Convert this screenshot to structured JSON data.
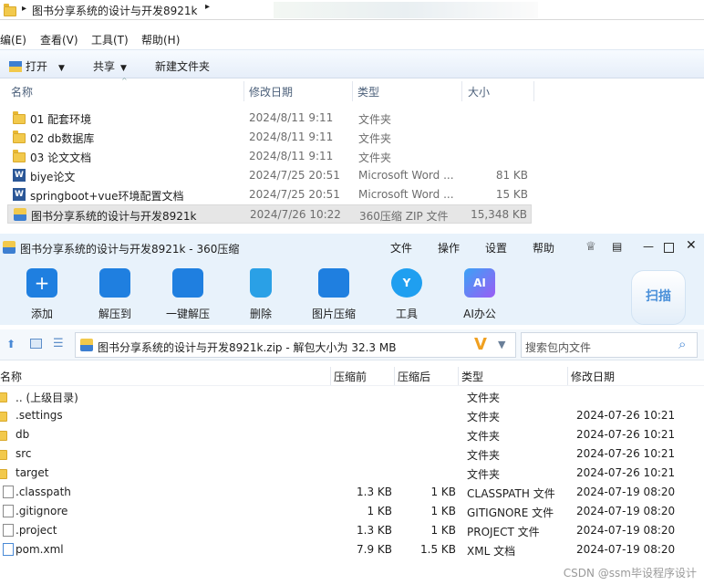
{
  "explorer": {
    "breadcrumb": "图书分享系统的设计与开发8921k",
    "menu": [
      "编(E)",
      "查看(V)",
      "工具(T)",
      "帮助(H)"
    ],
    "toolbar": {
      "open": "打开",
      "share": "共享",
      "new_folder": "新建文件夹"
    },
    "columns": [
      "名称",
      "修改日期",
      "类型",
      "大小"
    ],
    "files": [
      {
        "name": "01 配套环境",
        "date": "2024/8/11 9:11",
        "type": "文件夹",
        "size": "",
        "icon": "folder-icon"
      },
      {
        "name": "02 db数据库",
        "date": "2024/8/11 9:11",
        "type": "文件夹",
        "size": "",
        "icon": "folder-icon"
      },
      {
        "name": "03 论文文档",
        "date": "2024/8/11 9:11",
        "type": "文件夹",
        "size": "",
        "icon": "folder-icon"
      },
      {
        "name": "biye论文",
        "date": "2024/7/25 20:51",
        "type": "Microsoft Word ...",
        "size": "81 KB",
        "icon": "word-doc-icon"
      },
      {
        "name": "springboot+vue环境配置文档",
        "date": "2024/7/25 20:51",
        "type": "Microsoft Word ...",
        "size": "15 KB",
        "icon": "word-doc-icon"
      },
      {
        "name": "图书分享系统的设计与开发8921k",
        "date": "2024/7/26 10:22",
        "type": "360压缩 ZIP 文件",
        "size": "15,348 KB",
        "icon": "zip-icon",
        "selected": true
      }
    ]
  },
  "zip": {
    "title": "图书分享系统的设计与开发8921k - 360压缩",
    "menu": [
      "文件",
      "操作",
      "设置",
      "帮助"
    ],
    "tools": [
      {
        "label": "添加",
        "icon": "add-icon",
        "color": "#1f7fe0"
      },
      {
        "label": "解压到",
        "icon": "extract-to-icon",
        "color": "#1f7fe0"
      },
      {
        "label": "一键解压",
        "icon": "one-click-extract-icon",
        "color": "#1f7fe0"
      },
      {
        "label": "删除",
        "icon": "delete-icon",
        "color": "#2aa0e6"
      },
      {
        "label": "图片压缩",
        "icon": "image-compress-icon",
        "color": "#1f7fe0"
      },
      {
        "label": "工具",
        "icon": "tools-icon",
        "color": "#1f9ff0"
      },
      {
        "label": "AI办公",
        "icon": "ai-office-icon",
        "color": "#3aa3f5"
      }
    ],
    "scan": "扫描",
    "path": "图书分享系统的设计与开发8921k.zip - 解包大小为 32.3 MB",
    "search_placeholder": "搜索包内文件",
    "columns": [
      "名称",
      "压缩前",
      "压缩后",
      "类型",
      "修改日期"
    ],
    "files": [
      {
        "name": ".. (上级目录)",
        "before": "",
        "after": "",
        "type": "文件夹",
        "date": "",
        "icon": "folder-icon"
      },
      {
        "name": ".settings",
        "before": "",
        "after": "",
        "type": "文件夹",
        "date": "2024-07-26 10:21",
        "icon": "folder-icon"
      },
      {
        "name": "db",
        "before": "",
        "after": "",
        "type": "文件夹",
        "date": "2024-07-26 10:21",
        "icon": "folder-icon"
      },
      {
        "name": "src",
        "before": "",
        "after": "",
        "type": "文件夹",
        "date": "2024-07-26 10:21",
        "icon": "folder-icon"
      },
      {
        "name": "target",
        "before": "",
        "after": "",
        "type": "文件夹",
        "date": "2024-07-26 10:21",
        "icon": "folder-icon"
      },
      {
        "name": ".classpath",
        "before": "1.3 KB",
        "after": "1 KB",
        "type": "CLASSPATH 文件",
        "date": "2024-07-19 08:20",
        "icon": "file-icon"
      },
      {
        "name": ".gitignore",
        "before": "1 KB",
        "after": "1 KB",
        "type": "GITIGNORE 文件",
        "date": "2024-07-19 08:20",
        "icon": "file-icon"
      },
      {
        "name": ".project",
        "before": "1.3 KB",
        "after": "1 KB",
        "type": "PROJECT 文件",
        "date": "2024-07-19 08:20",
        "icon": "file-icon"
      },
      {
        "name": "pom.xml",
        "before": "7.9 KB",
        "after": "1.5 KB",
        "type": "XML 文档",
        "date": "2024-07-19 08:20",
        "icon": "xml-file-icon"
      }
    ]
  },
  "watermark": "CSDN @ssm毕设程序设计"
}
